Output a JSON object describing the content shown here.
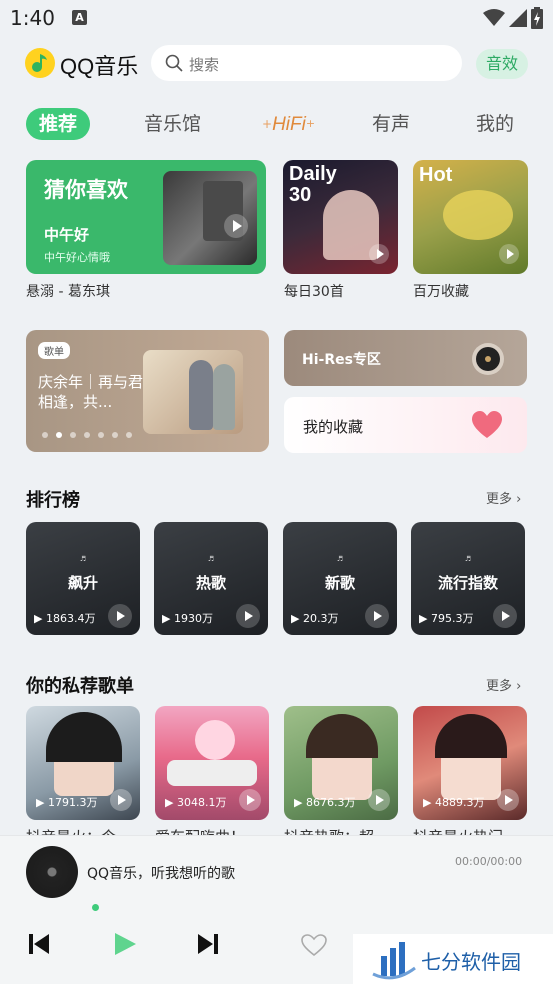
{
  "status": {
    "time": "1:40",
    "badge": "A"
  },
  "topbar": {
    "brand": "QQ音乐",
    "search_placeholder": "搜索",
    "effect_label": "音效"
  },
  "tabs": [
    {
      "label": "推荐"
    },
    {
      "label": "音乐馆"
    },
    {
      "label": "HiFi"
    },
    {
      "label": "有声"
    },
    {
      "label": "我的"
    }
  ],
  "featured": {
    "guess": {
      "title": "猜你喜欢",
      "subtitle": "中午好",
      "note": "中午好心情哦",
      "caption": "悬溺 - 葛东琪"
    },
    "daily": {
      "badge_line1": "Daily",
      "badge_line2": "30",
      "caption": "每日30首"
    },
    "hot": {
      "badge": "Hot",
      "caption": "百万收藏"
    }
  },
  "banner": {
    "tag": "歌单",
    "text": "庆余年｜再与君相逢，共..."
  },
  "hires": {
    "label": "Hi-Res专区"
  },
  "favs": {
    "label": "我的收藏"
  },
  "charts": {
    "title": "排行榜",
    "more": "更多",
    "items": [
      {
        "name": "飙升",
        "count": "1863.4万"
      },
      {
        "name": "热歌",
        "count": "1930万"
      },
      {
        "name": "新歌",
        "count": "20.3万"
      },
      {
        "name": "流行指数",
        "count": "795.3万"
      }
    ]
  },
  "recommend": {
    "title": "你的私荐歌单",
    "more": "更多",
    "items": [
      {
        "count": "1791.3万",
        "caption": "抖音最火：今"
      },
      {
        "count": "3048.1万",
        "caption": "爱车配嗨曲！"
      },
      {
        "count": "8676.3万",
        "caption": "抖音热歌：超"
      },
      {
        "count": "4889.3万",
        "caption": "抖音最火热门"
      }
    ]
  },
  "player": {
    "song": "QQ音乐，听我想听的歌",
    "time": "00:00/00:00"
  },
  "watermark": {
    "text": "七分软件园"
  },
  "colors": {
    "accent": "#3ecb7b",
    "background": "#eef1f4"
  }
}
